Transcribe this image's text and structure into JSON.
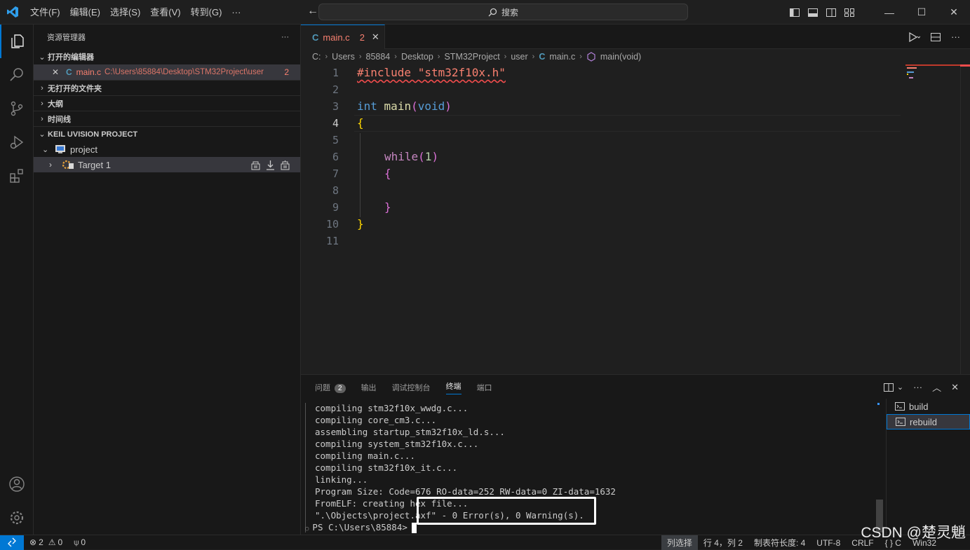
{
  "titlebar": {
    "menu": [
      "文件(F)",
      "编辑(E)",
      "选择(S)",
      "查看(V)",
      "转到(G)",
      "···"
    ],
    "search": "搜索"
  },
  "sidebar": {
    "title": "资源管理器",
    "more": "···",
    "open_editors": {
      "label": "打开的编辑器",
      "file": "main.c",
      "path": "C:\\Users\\85884\\Desktop\\STM32Project\\user",
      "count": "2"
    },
    "no_folder": "无打开的文件夹",
    "outline": "大纲",
    "timeline": "时间线",
    "keil": {
      "label": "KEIL UVISION PROJECT",
      "project": "project",
      "target": "Target 1"
    }
  },
  "editor": {
    "tab": {
      "label": "main.c",
      "count": "2",
      "icon": "C"
    },
    "breadcrumb": [
      "C:",
      "Users",
      "85884",
      "Desktop",
      "STM32Project",
      "user",
      "main.c",
      "main(void)"
    ],
    "lines": [
      "1",
      "2",
      "3",
      "4",
      "5",
      "6",
      "7",
      "8",
      "9",
      "10",
      "11"
    ],
    "code": {
      "l1": "#include \"stm32f10x.h\"",
      "l3_kw": "int",
      "l3_fn": "main",
      "l3_p1": "(",
      "l3_arg": "void",
      "l3_p2": ")",
      "l4": "{",
      "l6_kw": "while",
      "l6_p1": "(",
      "l6_num": "1",
      "l6_p2": ")",
      "l7": "{",
      "l9": "}",
      "l10": "}"
    }
  },
  "panel": {
    "tabs": [
      "问题",
      "输出",
      "调试控制台",
      "终端",
      "端口"
    ],
    "problems_count": "2",
    "terminal_lines": [
      "compiling stm32f10x_wwdg.c...",
      "compiling core_cm3.c...",
      "assembling startup_stm32f10x_ld.s...",
      "compiling system_stm32f10x.c...",
      "compiling main.c...",
      "compiling stm32f10x_it.c...",
      "linking...",
      "Program Size: Code=676 RO-data=252 RW-data=0 ZI-data=1632",
      "FromELF: creating hex file...",
      "\".\\Objects\\project.axf\" - 0 Error(s), 0 Warning(s)."
    ],
    "prompt": "PS C:\\Users\\85884>",
    "terminals": [
      "build",
      "rebuild"
    ]
  },
  "status": {
    "errors": "2",
    "warnings": "0",
    "ports": "0",
    "column_select": "列选择",
    "position": "行 4，列 2",
    "tab_size": "制表符长度: 4",
    "encoding": "UTF-8",
    "eol": "CRLF",
    "language": "{ } C",
    "platform": "Win32"
  },
  "watermark": "CSDN @楚灵魈",
  "colors": {
    "accent": "#0078d4",
    "error": "#f88070",
    "keyword": "#569cd6",
    "function": "#dcdcaa",
    "bracket": "#ffd700",
    "bracket2": "#da70d6",
    "number": "#b5cea8",
    "include": "#ce9178"
  }
}
